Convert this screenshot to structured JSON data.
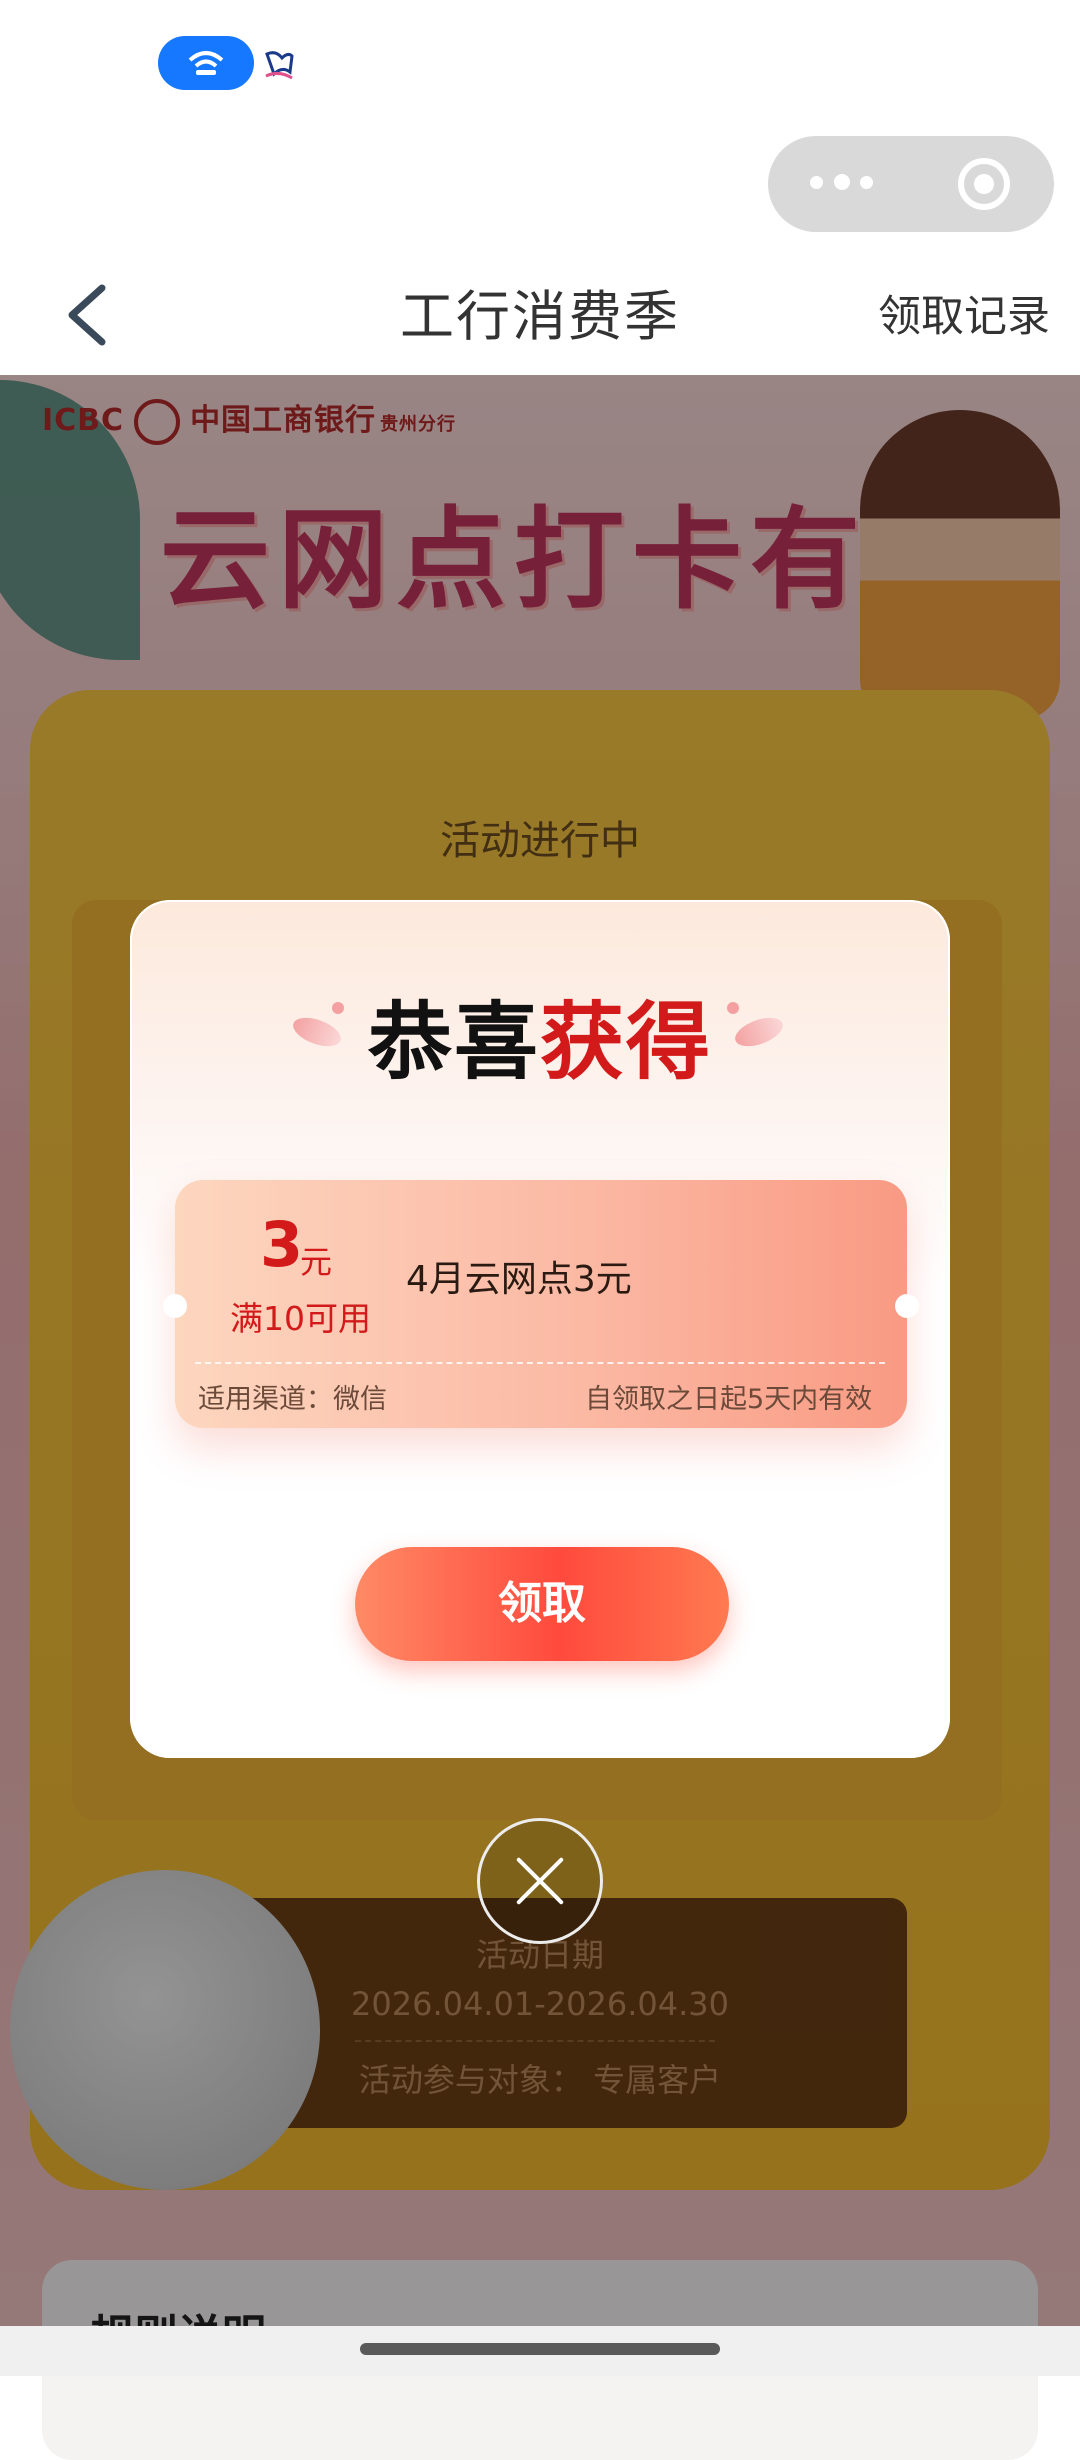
{
  "nav": {
    "title": "工行消费季",
    "right_link": "领取记录"
  },
  "background": {
    "bank_logo_text": "ICBC",
    "bank_name": "中国工商银行",
    "branch": "贵州分行",
    "banner": "云网点打卡有礼",
    "activity_status": "活动进行中",
    "date_label": "活动日期",
    "date_range": "2026.04.01-2026.04.30",
    "audience": "活动参与对象：  专属客户",
    "rules_title": "规则说明"
  },
  "modal": {
    "title_part1": "恭喜",
    "title_part2": "获得",
    "coupon": {
      "amount": "3",
      "unit": "元",
      "condition": "满10可用",
      "name": "4月云网点3元",
      "channel": "适用渠道：微信",
      "validity": "自领取之日起5天内有效"
    },
    "claim_button": "领取"
  },
  "colors": {
    "accent_red": "#d31a1a",
    "button_gradient_mid": "#ff4a3d",
    "status_pill": "#1677ff"
  }
}
